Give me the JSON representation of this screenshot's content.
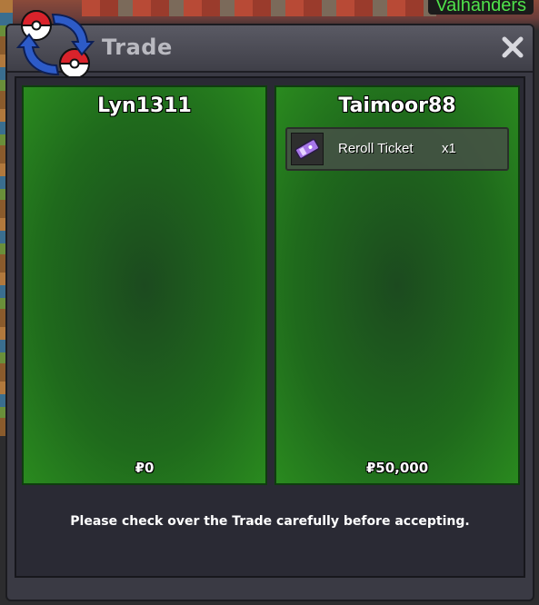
{
  "background": {
    "nameplate": "Valhanders"
  },
  "window": {
    "title": "Trade",
    "close_symbol": "✕"
  },
  "left_panel": {
    "player_name": "Lyn1311",
    "money": "₽0"
  },
  "right_panel": {
    "player_name": "Taimoor88",
    "items": [
      {
        "icon": "ticket-icon",
        "name": "Reroll Ticket",
        "quantity": "x1"
      }
    ],
    "money": "₽50,000"
  },
  "footer": {
    "message": "Please check over the Trade carefully before accepting."
  },
  "colors": {
    "panel_green": "#1f6a1c",
    "nameplate_text": "#4fe24a",
    "window_bg": "#3a3a44"
  }
}
